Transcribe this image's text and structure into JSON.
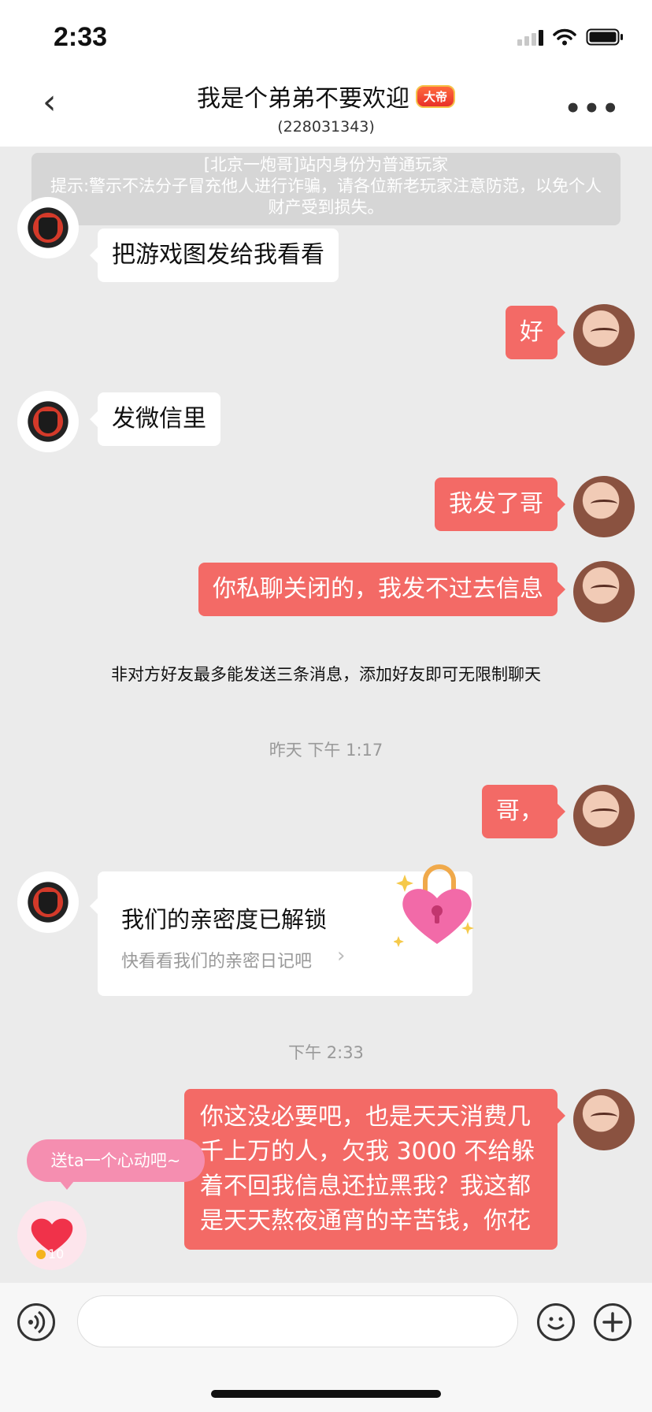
{
  "status_bar": {
    "time": "2:33"
  },
  "header": {
    "back_icon": "chevron-left-icon",
    "title": "我是个弟弟不要欢迎",
    "badge": "大帝",
    "user_id": "(228031343)",
    "more_icon": "more-dots-icon"
  },
  "notice": {
    "text": "[北京一炮哥]站内身份为普通玩家\n提示:警示不法分子冒充他人进行诈骗，请各位新老玩家注意防范，以免个人财产受到损失。"
  },
  "messages": [
    {
      "side": "in",
      "text": "把游戏图发给我看看"
    },
    {
      "side": "out",
      "text": "好"
    },
    {
      "side": "in",
      "text": "发微信里"
    },
    {
      "side": "out",
      "text": "我发了哥"
    },
    {
      "side": "out",
      "text": "你私聊关闭的，我发不过去信息"
    },
    {
      "side": "out",
      "text": "哥，"
    },
    {
      "side": "out",
      "text": "你这没必要吧，也是天天消费几千上万的人，欠我 3000 不给躲着不回我信息还拉黑我？我这都是天天熬夜通宵的辛苦钱，你花"
    }
  ],
  "system_notice": "非对方好友最多能发送三条消息，添加好友即可无限制聊天",
  "timestamps": {
    "t1": "昨天 下午 1:17",
    "t2": "下午 2:33"
  },
  "intimacy_card": {
    "title": "我们的亲密度已解锁",
    "subtitle": "快看看我们的亲密日记吧",
    "icon": "heart-lock-icon"
  },
  "gift_prompt": {
    "text": "送ta一个心动吧~",
    "count": "10"
  },
  "input_bar": {
    "voice_icon": "voice-icon",
    "placeholder": "",
    "emoji_icon": "emoji-icon",
    "add_icon": "plus-icon"
  },
  "colors": {
    "outgoing": "#f36a66",
    "incoming": "#ffffff",
    "background": "#ebebeb",
    "pill": "#f58eb0"
  }
}
